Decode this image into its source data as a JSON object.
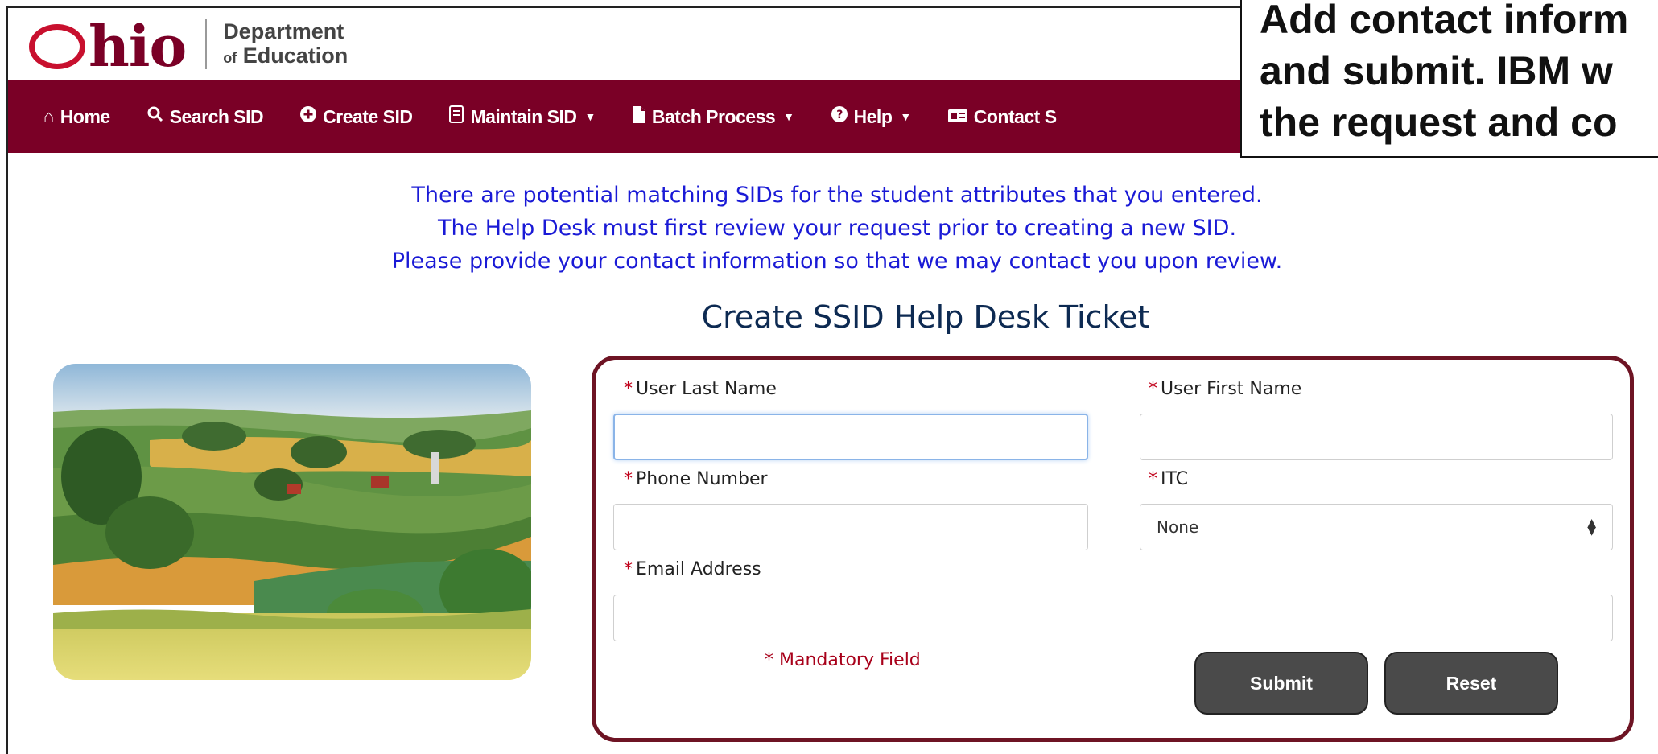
{
  "header": {
    "logo_ohio_rest": "hio",
    "dept_line1": "Department",
    "dept_line2_prefix": "of",
    "dept_line2": "Education"
  },
  "nav": {
    "items": [
      {
        "label": "Home",
        "icon": "home-icon"
      },
      {
        "label": "Search SID",
        "icon": "search-icon"
      },
      {
        "label": "Create SID",
        "icon": "plus-circle-icon"
      },
      {
        "label": "Maintain SID",
        "icon": "id-card-icon",
        "dropdown": true
      },
      {
        "label": "Batch Process",
        "icon": "file-icon",
        "dropdown": true
      },
      {
        "label": "Help",
        "icon": "question-circle-icon",
        "dropdown": true
      },
      {
        "label": "Contact S",
        "icon": "card-icon"
      }
    ]
  },
  "callout": {
    "line1": "Add contact inform",
    "line2": "and submit. IBM w",
    "line3": "the request and co"
  },
  "message": {
    "line1": "There are potential matching SIDs for the student attributes that you entered.",
    "line2": "The Help Desk must first review your request prior to creating a new SID.",
    "line3": "Please provide your contact information so that we may contact you upon review."
  },
  "form": {
    "title": "Create SSID Help Desk Ticket",
    "required_marker": "*",
    "last_name_label": "User Last Name",
    "last_name_value": "",
    "first_name_label": "User First Name",
    "first_name_value": "",
    "phone_label": "Phone Number",
    "phone_value": "",
    "itc_label": "ITC",
    "itc_selected": "None",
    "email_label": "Email Address",
    "email_value": "",
    "mandatory_note": "* Mandatory Field",
    "submit_label": "Submit",
    "reset_label": "Reset"
  },
  "colors": {
    "brand_maroon": "#7a0026",
    "message_blue": "#1a1ad6",
    "required_red": "#c0001a"
  }
}
